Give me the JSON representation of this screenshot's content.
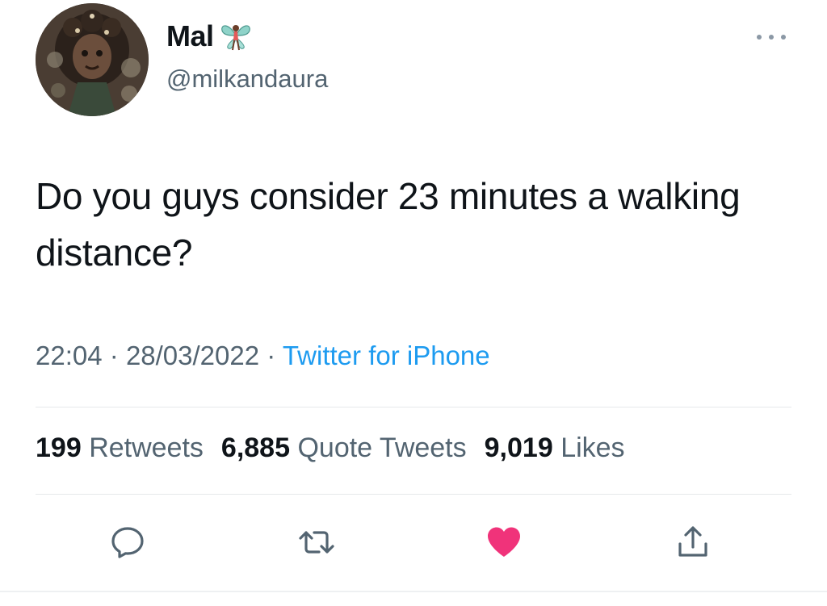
{
  "author": {
    "display_name": "Mal",
    "name_emoji": "fairy-icon",
    "handle": "@milkandaura"
  },
  "tweet": {
    "text": "Do you guys consider 23 minutes a walking distance?",
    "time": "22:04",
    "date": "28/03/2022",
    "separator": "·",
    "source": "Twitter for iPhone"
  },
  "stats": {
    "retweets_count": "199",
    "retweets_label": "Retweets",
    "quotes_count": "6,885",
    "quotes_label": "Quote Tweets",
    "likes_count": "9,019",
    "likes_label": "Likes"
  },
  "actions": {
    "reply_icon": "comment-icon",
    "retweet_icon": "retweet-icon",
    "like_icon": "heart-icon",
    "share_icon": "share-icon",
    "liked": true
  },
  "colors": {
    "text": "#0f1419",
    "secondary": "#536471",
    "link": "#1d9bf0",
    "like": "#f0337a",
    "divider": "#e6e9eb"
  }
}
